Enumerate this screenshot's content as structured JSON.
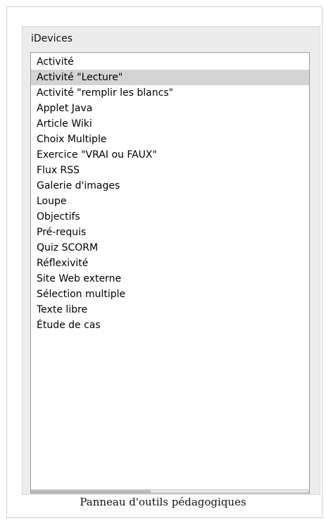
{
  "panel": {
    "title": "iDevices",
    "items": [
      {
        "label": "Activité",
        "selected": false
      },
      {
        "label": "Activité \"Lecture\"",
        "selected": true
      },
      {
        "label": "Activité \"remplir les blancs\"",
        "selected": false
      },
      {
        "label": "Applet Java",
        "selected": false
      },
      {
        "label": "Article Wiki",
        "selected": false
      },
      {
        "label": "Choix Multiple",
        "selected": false
      },
      {
        "label": "Exercice \"VRAI ou FAUX\"",
        "selected": false
      },
      {
        "label": "Flux RSS",
        "selected": false
      },
      {
        "label": "Galerie d'images",
        "selected": false
      },
      {
        "label": "Loupe",
        "selected": false
      },
      {
        "label": "Objectifs",
        "selected": false
      },
      {
        "label": "Pré-requis",
        "selected": false
      },
      {
        "label": "Quiz SCORM",
        "selected": false
      },
      {
        "label": "Réflexivité",
        "selected": false
      },
      {
        "label": "Site Web externe",
        "selected": false
      },
      {
        "label": "Sélection multiple",
        "selected": false
      },
      {
        "label": "Texte libre",
        "selected": false
      },
      {
        "label": "Étude de cas",
        "selected": false
      }
    ]
  },
  "caption": "Panneau d'outils pédagogiques",
  "colors": {
    "selected_background": "#d4d4d4",
    "panel_background": "#ececec",
    "list_border": "#9a9a9a"
  }
}
